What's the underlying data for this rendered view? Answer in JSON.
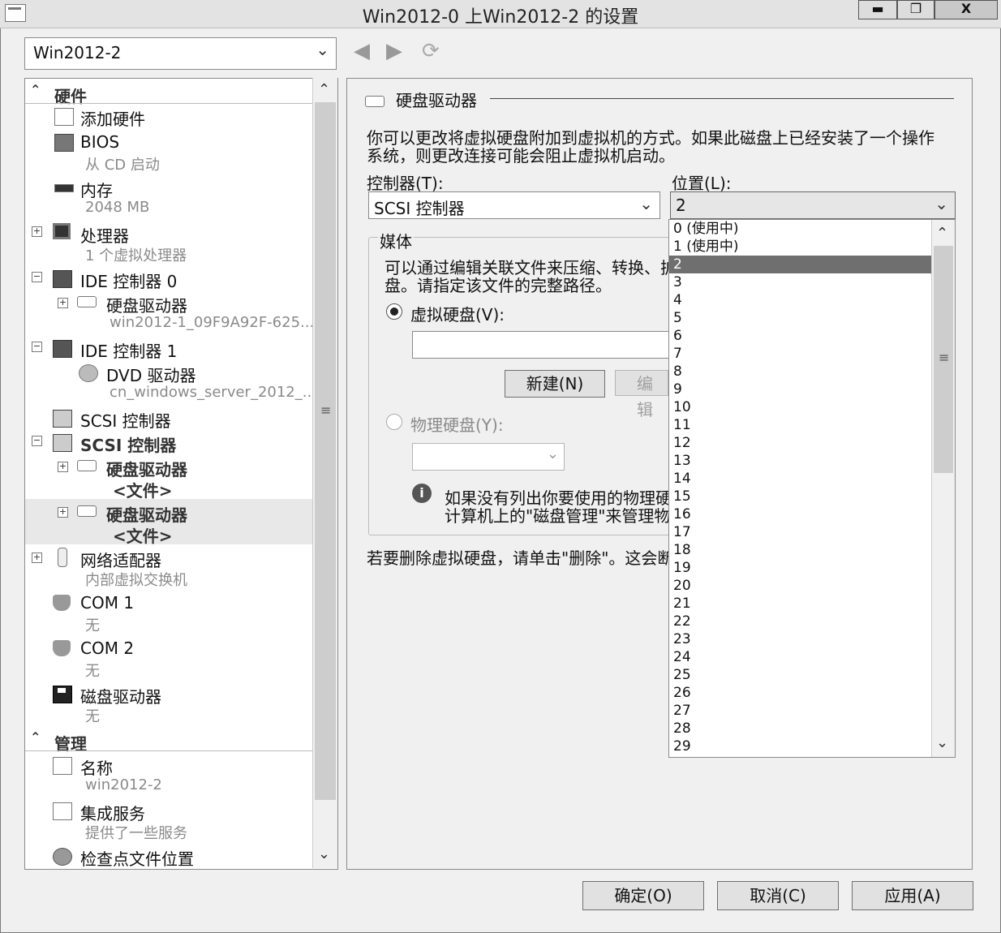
{
  "window": {
    "title": "Win2012-0 上Win2012-2 的设置",
    "minimize": "▬",
    "maximize": "❐",
    "close": "X"
  },
  "vm_selector": {
    "value": "Win2012-2"
  },
  "tree": {
    "hardware_section": "硬件",
    "management_section": "管理",
    "items": {
      "add_hardware": "添加硬件",
      "bios": "BIOS",
      "bios_sub": "从 CD 启动",
      "memory": "内存",
      "memory_sub": "2048 MB",
      "processor": "处理器",
      "processor_sub": "1 个虚拟处理器",
      "ide0": "IDE 控制器 0",
      "ide0_disk": "硬盘驱动器",
      "ide0_disk_sub": "win2012-1_09F9A92F-625...",
      "ide1": "IDE 控制器 1",
      "dvd": "DVD 驱动器",
      "dvd_sub": "cn_windows_server_2012_...",
      "scsi1": "SCSI 控制器",
      "scsi2": "SCSI 控制器",
      "scsi_disk1": "硬盘驱动器",
      "scsi_disk1_sub": "<文件>",
      "scsi_disk2": "硬盘驱动器",
      "scsi_disk2_sub": "<文件>",
      "network": "网络适配器",
      "network_sub": "内部虚拟交换机",
      "com1": "COM 1",
      "com1_sub": "无",
      "com2": "COM 2",
      "com2_sub": "无",
      "floppy": "磁盘驱动器",
      "floppy_sub": "无",
      "name": "名称",
      "name_sub": "win2012-2",
      "integration": "集成服务",
      "integration_sub": "提供了一些服务",
      "checkpoint": "检查点文件位置"
    }
  },
  "detail": {
    "heading": "硬盘驱动器",
    "description_line1": "你可以更改将虚拟硬盘附加到虚拟机的方式。如果此磁盘上已经安装了一个操作",
    "description_line2": "系统，则更改连接可能会阻止虚拟机启动。",
    "controller_label": "控制器(T):",
    "controller_value": "SCSI 控制器",
    "location_label": "位置(L):",
    "location_value": "2",
    "media_title": "媒体",
    "media_desc_line1": "可以通过编辑关联文件来压缩、转换、扩",
    "media_desc_line2": "盘。请指定该文件的完整路径。",
    "virtual_disk_label": "虚拟硬盘(V):",
    "virtual_disk_value": "",
    "new_button": "新建(N)",
    "edit_button": "编辑",
    "physical_disk_label": "物理硬盘(Y):",
    "info_line1": "如果没有列出你要使用的物理硬",
    "info_line2": "计算机上的\"磁盘管理\"来管理物",
    "remove_text": "若要删除虚拟硬盘，请单击\"删除\"。这会断"
  },
  "location_dropdown": {
    "options": [
      "0 (使用中)",
      "1 (使用中)",
      "2",
      "3",
      "4",
      "5",
      "6",
      "7",
      "8",
      "9",
      "10",
      "11",
      "12",
      "13",
      "14",
      "15",
      "16",
      "17",
      "18",
      "19",
      "20",
      "21",
      "22",
      "23",
      "24",
      "25",
      "26",
      "27",
      "28",
      "29"
    ],
    "selected_index": 2
  },
  "footer": {
    "ok": "确定(O)",
    "cancel": "取消(C)",
    "apply": "应用(A)"
  }
}
